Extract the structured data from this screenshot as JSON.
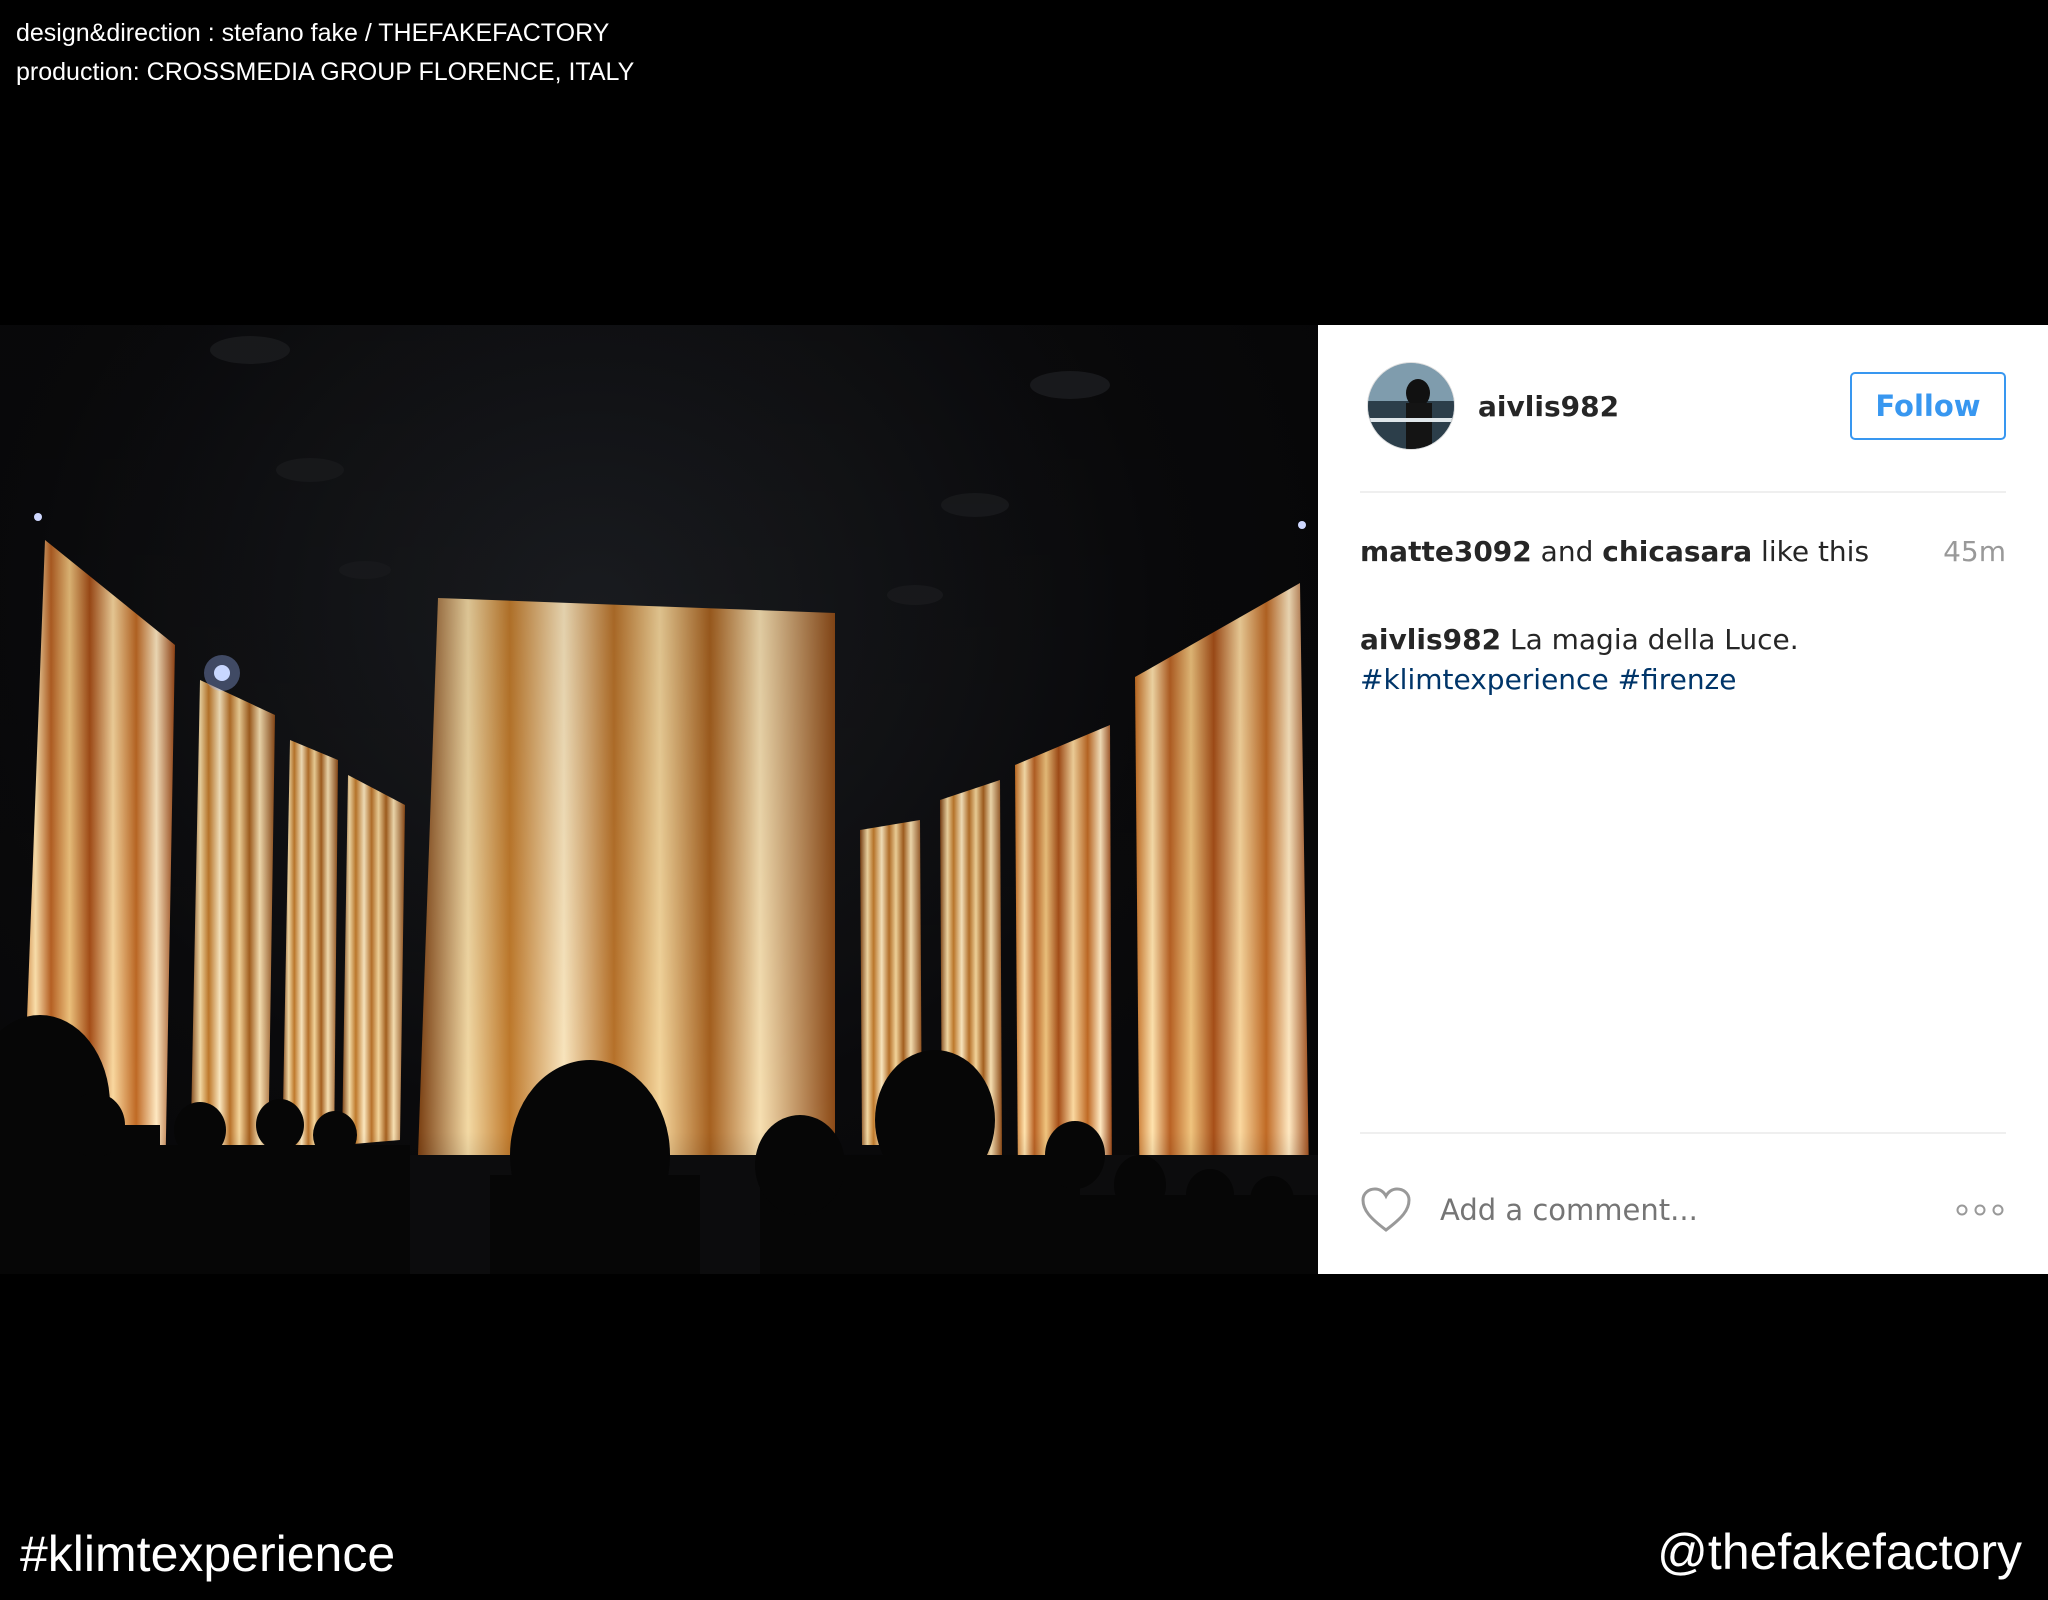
{
  "credits": {
    "line1": "design&direction : stefano fake / THEFAKEFACTORY",
    "line2": "production: CROSSMEDIA GROUP FLORENCE, ITALY"
  },
  "post": {
    "username": "aivlis982",
    "follow_label": "Follow",
    "likes": {
      "user1": "matte3092",
      "connector": " and ",
      "user2": "chicasara",
      "suffix": " like this",
      "time": "45m"
    },
    "caption": {
      "author": "aivlis982",
      "text": " La magia della Luce.",
      "hashtag1": "#klimtexperience",
      "hashtag2": "#firenze"
    },
    "comment_placeholder": "Add a comment...",
    "icons": {
      "like": "heart-icon",
      "more": "more-options-icon"
    },
    "colors": {
      "follow": "#3897f0",
      "hashtag": "#003569",
      "panel_bg": "#ffffff",
      "text": "#262626",
      "muted": "#999999"
    }
  },
  "footer": {
    "hashtag": "#klimtexperience",
    "handle": "@thefakefactory"
  }
}
